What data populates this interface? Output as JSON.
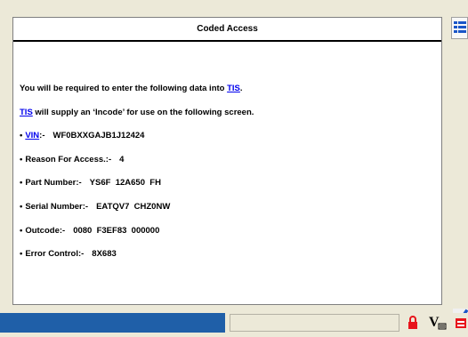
{
  "panel": {
    "title": "Coded Access"
  },
  "instructions": {
    "line1_text": "You will be required to enter the following data into ",
    "line1_link": "TIS",
    "line1_end": ".",
    "line2_link": "TIS",
    "line2_text": " will supply an ‘Incode’ for use on the following screen."
  },
  "fields": {
    "bullet": "•",
    "vin_link": "VIN",
    "vin_label": ":-",
    "vin_value": "WF0BXXGAJB1J12424",
    "reason_label": "Reason For Access.:-",
    "reason_value": "4",
    "part_label": "Part Number:-",
    "part_value": "YS6F  12A650  FH",
    "serial_label": "Serial Number:-",
    "serial_value": "EATQV7  CHZ0NW",
    "outcode_label": "Outcode:-",
    "outcode_value": "0080  F3EF83  000000",
    "error_label": "Error Control:-",
    "error_value": "8X683"
  },
  "status_bar": {
    "v_letter": "V"
  },
  "colors": {
    "link": "#0000ee",
    "status_blue": "#1f5fa8",
    "lock_red": "#e8141b",
    "confirm_blue": "#1a56c8"
  },
  "icons": [
    "menu-list-icon",
    "checkmark-icon",
    "lock-icon",
    "vehicle-comm-icon",
    "battery-icon"
  ]
}
